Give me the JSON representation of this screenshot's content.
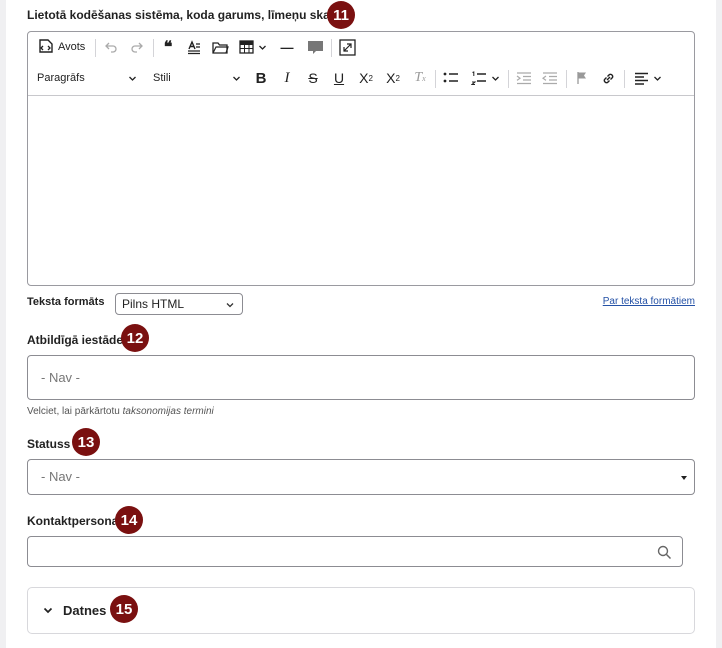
{
  "coding_field": {
    "label": "Lietotā kodēšanas sistēma, koda garums, līmeņu skaits",
    "badge": "11"
  },
  "toolbar": {
    "source_label": "Avots",
    "paragraph_label": "Paragrāfs",
    "styles_label": "Stili",
    "bold": "B",
    "italic": "I",
    "strike": "S",
    "underline": "U",
    "superscript": "X",
    "superscript_mark": "2",
    "subscript": "X",
    "subscript_mark": "2",
    "remove_format": "T",
    "remove_format_mark": "x",
    "blockquote": "❝",
    "horizontal_rule": "—"
  },
  "text_format": {
    "label": "Teksta formāts",
    "selected": "Pilns HTML",
    "help_link": "Par teksta formātiem"
  },
  "institution_field": {
    "label": "Atbildīgā iestāde",
    "badge": "12",
    "placeholder": "- Nav -",
    "helper_prefix": "Velciet, lai pārkārtotu ",
    "helper_emphasis": "taksonomijas termini"
  },
  "status_field": {
    "label": "Statuss",
    "badge": "13",
    "selected": "- Nav -"
  },
  "contact_field": {
    "label": "Kontaktpersona",
    "badge": "14",
    "value": ""
  },
  "files_section": {
    "label": "Datnes",
    "badge": "15"
  },
  "colors": {
    "badge": "#7a1010",
    "link": "#2451a6"
  }
}
